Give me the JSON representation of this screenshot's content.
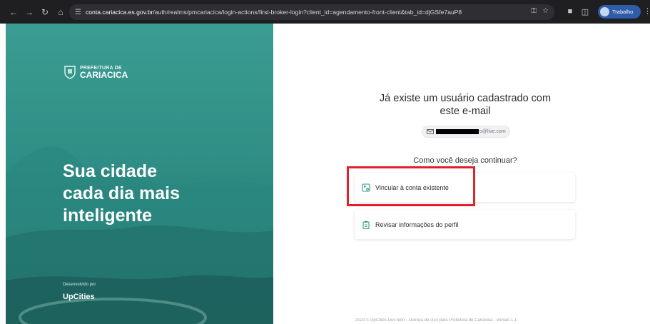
{
  "browser": {
    "url_host": "conta.cariacica.es.gov.br",
    "url_path": "/auth/realms/pmcariacica/login-actions/first-broker-login?client_id=agendamento-front-client&tab_id=djGSfe7auP8",
    "profile_label": "Trabalho"
  },
  "hero": {
    "logo_line1": "PREFEITURA DE",
    "logo_line2": "CARIACICA",
    "headline_line1": "Sua cidade",
    "headline_line2": "cada dia mais",
    "headline_line3": "inteligente",
    "dev_by": "Desenvolvido por",
    "brand": "UpCities"
  },
  "form": {
    "title_line1": "Já existe um usuário cadastrado com",
    "title_line2": "este e-mail",
    "email_tail": "o@live.com",
    "question": "Como você deseja continuar?",
    "options": [
      {
        "label": "Vincular à conta existente",
        "icon": "link-account-icon"
      },
      {
        "label": "Revisar informações do perfil",
        "icon": "clipboard-icon"
      }
    ],
    "footer": "2023 © UpCities GovTech - Licença de Uso para Prefeitura de Cariacica - Versão 1.1"
  },
  "colors": {
    "hero": "#2f8f86",
    "highlight": "#e0202a",
    "chrome": "#1f1f22"
  }
}
